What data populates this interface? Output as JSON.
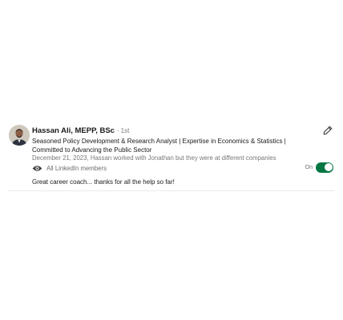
{
  "recommendation": {
    "author": {
      "name": "Hassan Ali, MEPP, BSc",
      "separator": "·",
      "degree": "1st",
      "headline": "Seasoned Policy Development & Research Analyst | Expertise in Economics & Statistics | Committed to Advancing the Public Sector"
    },
    "meta": "December 21, 2023, Hassan worked with Jonathan but they were at different companies",
    "visibility": {
      "icon": "eye-icon",
      "label": "All LinkedIn members"
    },
    "toggle": {
      "label": "On",
      "state": "on",
      "color": "#057642"
    },
    "text": "Great career coach... thanks for all the help so far!",
    "edit_icon": "pencil-icon"
  }
}
